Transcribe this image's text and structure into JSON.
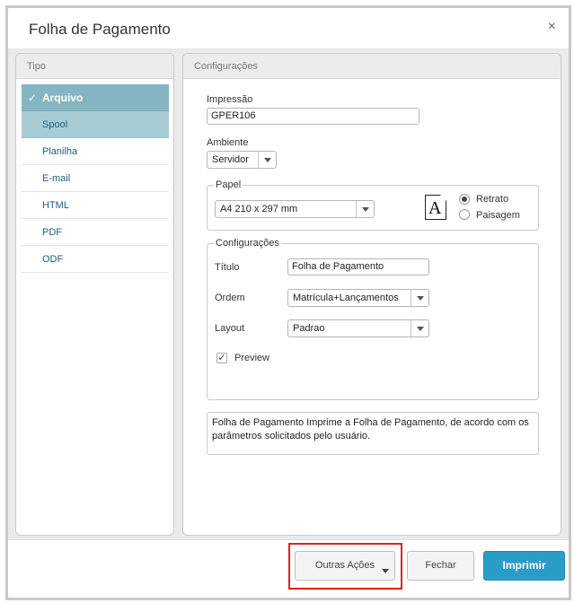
{
  "dialog": {
    "title": "Folha de Pagamento",
    "close_glyph": "×"
  },
  "tipo": {
    "header": "Tipo",
    "items": [
      {
        "label": "Arquivo",
        "check": "✓"
      },
      {
        "label": "Spool"
      },
      {
        "label": "Planilha"
      },
      {
        "label": "E-mail"
      },
      {
        "label": "HTML"
      },
      {
        "label": "PDF"
      },
      {
        "label": "ODF"
      }
    ]
  },
  "config": {
    "header": "Configurações",
    "impressao_label": "Impressão",
    "impressao_value": "GPER106",
    "ambiente_label": "Ambiente",
    "ambiente_value": "Servidor",
    "papel": {
      "legend": "Papel",
      "size_value": "A4 210 x 297 mm",
      "page_icon_letter": "A",
      "retrato_label": "Retrato",
      "paisagem_label": "Paisagem",
      "selected": "Retrato"
    },
    "configuracoes": {
      "legend": "Configurações",
      "titulo_label": "Título",
      "titulo_value": "Folha de Pagamento",
      "ordem_label": "Ordem",
      "ordem_value": "Matrícula+Lançamentos",
      "layout_label": "Layout",
      "layout_value": "Padrao",
      "preview_label": "Preview",
      "preview_checked": true,
      "check_glyph": "✓"
    },
    "description": "Folha de Pagamento Imprime a Folha de Pagamento, de acordo com os parâmetros solicitados pelo usuário."
  },
  "footer": {
    "outras_label": "Outras Ações",
    "fechar_label": "Fechar",
    "imprimir_label": "Imprimir"
  },
  "colors": {
    "accent": "#2a9cc8",
    "selected_item": "#85b5c2",
    "highlight": "#e02020"
  }
}
